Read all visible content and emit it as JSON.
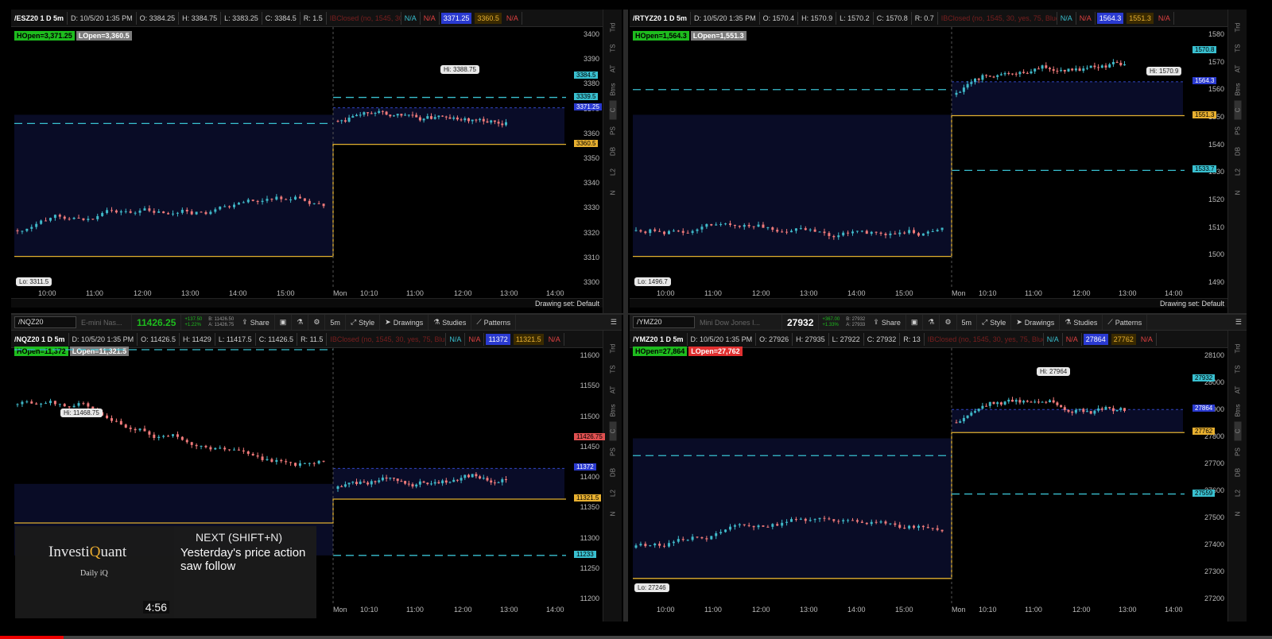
{
  "panels": [
    {
      "id": "es",
      "symbol": "/ESZ20 1 D 5m",
      "date": "D: 10/5/20 1:35 PM",
      "o": "O: 3384.25",
      "h": "H: 3384.75",
      "l": "L: 3383.25",
      "c": "C: 3384.5",
      "r": "R: 1.5",
      "ibox": "IBClosed (no, 1545, 30, yes, 75, Blue)",
      "na1": "N/A",
      "na2": "N/A",
      "box1": "3371.25",
      "box2": "3360.5",
      "na3": "N/A",
      "hopen": "HOpen=3,371.25",
      "lopen": "LOpen=3,360.5",
      "hi": "Hi: 3388.75",
      "lo": "Lo: 3311.5",
      "yticks": [
        "3400",
        "3390",
        "3380",
        "3370",
        "3360",
        "3350",
        "3340",
        "3330",
        "3320",
        "3310",
        "3300"
      ],
      "xticks": [
        "10:00",
        "11:00",
        "12:00",
        "13:00",
        "14:00",
        "15:00",
        "Mon",
        "10:10",
        "11:00",
        "12:00",
        "13:00",
        "14:00"
      ],
      "tags": [
        {
          "text": "3384.5",
          "bg": "#39c0d0"
        },
        {
          "text": "3371.25",
          "bg": "#2a3ad0"
        },
        {
          "text": "3360.5",
          "bg": "#e8b030"
        },
        {
          "text": "3339.5",
          "bg": "#39c0d0"
        }
      ],
      "drawing": "Drawing set: Default"
    },
    {
      "id": "rty",
      "symbol": "/RTYZ20 1 D 5m",
      "date": "D: 10/5/20 1:35 PM",
      "o": "O: 1570.4",
      "h": "H: 1570.9",
      "l": "L: 1570.2",
      "c": "C: 1570.8",
      "r": "R: 0.7",
      "ibox": "IBClosed (no, 1545, 30, yes, 75, Blue)",
      "na1": "N/A",
      "na2": "N/A",
      "box1": "1564.3",
      "box2": "1551.3",
      "na3": "N/A",
      "hopen": "HOpen=1,564.3",
      "lopen": "LOpen=1,551.3",
      "hi": "Hi: 1570.9",
      "lo": "Lo: 1496.7",
      "yticks": [
        "1580",
        "1570",
        "1560",
        "1550",
        "1540",
        "1530",
        "1520",
        "1510",
        "1500",
        "1490"
      ],
      "xticks": [
        "10:00",
        "11:00",
        "12:00",
        "13:00",
        "14:00",
        "15:00",
        "Mon",
        "10:10",
        "11:00",
        "12:00",
        "13:00",
        "14:00"
      ],
      "tags": [
        {
          "text": "1570.8",
          "bg": "#39c0d0"
        },
        {
          "text": "1564.3",
          "bg": "#2a3ad0"
        },
        {
          "text": "1551.3",
          "bg": "#e8b030"
        },
        {
          "text": "1533.7",
          "bg": "#39c0d0"
        }
      ],
      "drawing": "Drawing set: Default"
    },
    {
      "id": "nq",
      "symbol": "/NQZ20 1 D 5m",
      "date": "D: 10/5/20 1:35 PM",
      "o": "O: 11426.5",
      "h": "H: 11429",
      "l": "L: 11417.5",
      "c": "C: 11426.5",
      "r": "R: 11.5",
      "ibox": "IBClosed (no, 1545, 30, yes, 75, Blue)",
      "na1": "N/A",
      "na2": "N/A",
      "box1": "11372",
      "box2": "11321.5",
      "na3": "N/A",
      "hopen": "HOpen=11,372",
      "lopen": "LOpen=11,321.5",
      "hi": "Hi: 11468.75",
      "lo": "",
      "yticks": [
        "11600",
        "11550",
        "11500",
        "11450",
        "11400",
        "11350",
        "11300",
        "11250",
        "11200"
      ],
      "xticks": [
        "Mon",
        "10:10",
        "11:00",
        "12:00",
        "13:00",
        "14:00"
      ],
      "tags": [
        {
          "text": "11426.75",
          "bg": "#e05050"
        },
        {
          "text": "11372",
          "bg": "#2a3ad0"
        },
        {
          "text": "11321.5",
          "bg": "#e8b030"
        },
        {
          "text": "11233",
          "bg": "#39c0d0"
        }
      ],
      "toolbar": {
        "symbol": "/NQZ20",
        "desc": "E-mini Nas...",
        "last": "11426.25",
        "chg": "+137.50",
        "pct": "+1.22%",
        "bid": "B: 11426.50",
        "ask": "A: 11426.75",
        "share": "Share",
        "tf": "5m",
        "style": "Style",
        "drawings": "Drawings",
        "studies": "Studies",
        "patterns": "Patterns"
      }
    },
    {
      "id": "ym",
      "symbol": "/YMZ20 1 D 5m",
      "date": "D: 10/5/20 1:35 PM",
      "o": "O: 27926",
      "h": "H: 27935",
      "l": "L: 27922",
      "c": "C: 27932",
      "r": "R: 13",
      "ibox": "IBClosed (no, 1545, 30, yes, 75, Blue)",
      "na1": "N/A",
      "na2": "N/A",
      "box1": "27864",
      "box2": "27762",
      "na3": "N/A",
      "hopen": "HOpen=27,864",
      "lopen": "LOpen=27,762",
      "hi": "Hi: 27964",
      "lo": "Lo: 27246",
      "yticks": [
        "28100",
        "28000",
        "27900",
        "27800",
        "27700",
        "27600",
        "27500",
        "27400",
        "27300",
        "27200"
      ],
      "xticks": [
        "10:00",
        "11:00",
        "12:00",
        "13:00",
        "14:00",
        "15:00",
        "Mon",
        "10:10",
        "11:00",
        "12:00",
        "13:00",
        "14:00"
      ],
      "tags": [
        {
          "text": "27932",
          "bg": "#39c0d0"
        },
        {
          "text": "27864",
          "bg": "#2a3ad0"
        },
        {
          "text": "27762",
          "bg": "#e8b030"
        },
        {
          "text": "27559",
          "bg": "#39c0d0"
        }
      ],
      "toolbar": {
        "symbol": "/YMZ20",
        "desc": "Mini Dow Jones I...",
        "last": "27932",
        "chg": "+367.00",
        "pct": "+1.33%",
        "bid": "B: 27932",
        "ask": "A: 27933",
        "share": "Share",
        "tf": "5m",
        "style": "Style",
        "drawings": "Drawings",
        "studies": "Studies",
        "patterns": "Patterns"
      }
    }
  ],
  "sidebar": [
    "Trd",
    "TS",
    "AT",
    "Btns",
    "C",
    "PS",
    "DB",
    "L2",
    "N"
  ],
  "overlay": {
    "brand_pre": "Investi",
    "brand_q": "Q",
    "brand_post": "uant",
    "sub": "Daily iQ",
    "duration": "4:56",
    "next": "NEXT (SHIFT+N)",
    "text": "Yesterday's price action saw follow"
  },
  "video_progress_percent": 5,
  "colors": {
    "up": "#3fb8c8",
    "down": "#f07a7a",
    "gold": "#e0b030",
    "blue": "#2a3ad0",
    "cyan": "#39c0d0"
  }
}
